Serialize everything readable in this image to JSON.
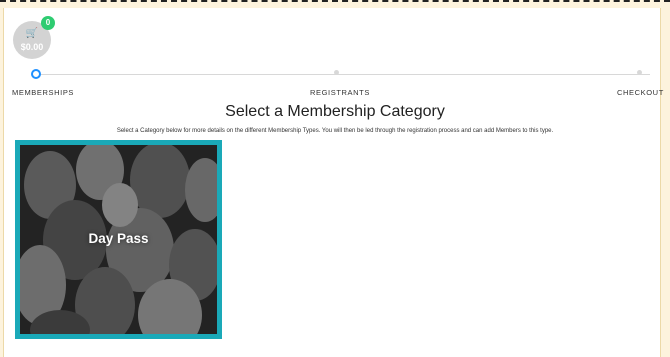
{
  "cart": {
    "icon": "cart-icon",
    "glyph": "🛒",
    "total": "$0.00",
    "count": "0"
  },
  "progress": {
    "steps": [
      {
        "label": "MEMBERSHIPS",
        "active": true
      },
      {
        "label": "REGISTRANTS",
        "active": false
      },
      {
        "label": "CHECKOUT",
        "active": false
      }
    ]
  },
  "main": {
    "title": "Select a Membership Category",
    "description": "Select a Category below for more details on the different Membership Types. You will then be led through the registration process and can add Members to this type."
  },
  "categories": [
    {
      "label": "Day Pass"
    }
  ],
  "colors": {
    "accent_teal": "#1aa9b8",
    "badge_green": "#2ecc71",
    "active_step_blue": "#1e90ff"
  }
}
